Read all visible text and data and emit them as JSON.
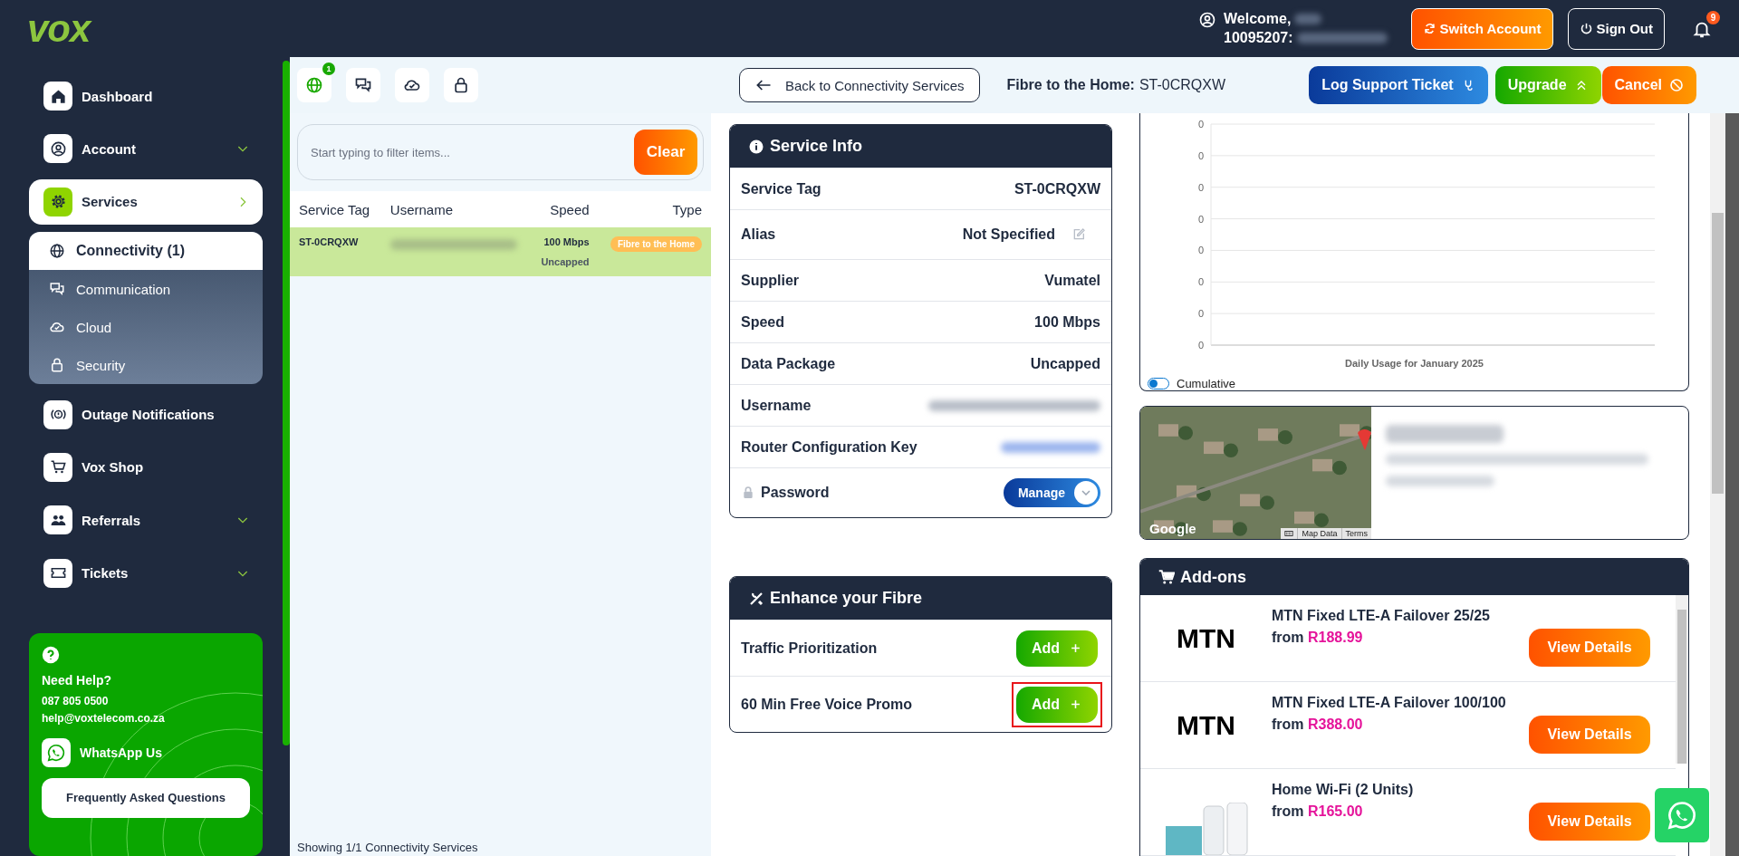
{
  "header": {
    "brand": "vox",
    "welcome": "Welcome,",
    "account_number": "10095207:",
    "buttons": [
      {
        "label": "Switch Account",
        "kind": "switch"
      },
      {
        "label": "Sign Out",
        "kind": "signout"
      }
    ],
    "notifications": {
      "count": "9"
    }
  },
  "sidebar": {
    "items": [
      {
        "label": "Dashboard",
        "has_submenu": false,
        "expanded": false,
        "selected": false
      },
      {
        "label": "Account",
        "has_submenu": true,
        "expanded": false,
        "selected": false
      },
      {
        "label": "Services",
        "has_submenu": true,
        "expanded": true,
        "selected": true,
        "children": [
          {
            "label": "Connectivity (1)",
            "selected": true
          },
          {
            "label": "Communication",
            "selected": false
          },
          {
            "label": "Cloud",
            "selected": false
          },
          {
            "label": "Security",
            "selected": false
          }
        ]
      },
      {
        "label": "Outage Notifications",
        "has_submenu": false,
        "expanded": false,
        "selected": false
      },
      {
        "label": "Vox Shop",
        "has_submenu": false,
        "expanded": false,
        "selected": false
      },
      {
        "label": "Referrals",
        "has_submenu": true,
        "expanded": false,
        "selected": false
      },
      {
        "label": "Tickets",
        "has_submenu": true,
        "expanded": false,
        "selected": false
      }
    ],
    "help": {
      "title": "Need Help?",
      "phone": "087 805 0500",
      "email": "help@voxtelecom.co.za",
      "whatsapp": "WhatsApp Us",
      "faq": "Frequently Asked Questions"
    }
  },
  "toolbar": {
    "service_tabs": [
      {
        "selected": true,
        "badge": "1"
      },
      {
        "selected": false
      },
      {
        "selected": false
      },
      {
        "selected": false
      }
    ],
    "back_button": "Back to Connectivity Services",
    "service_title": "Fibre to the Home:",
    "service_tag": "ST-0CRQXW",
    "actions": [
      {
        "label": "Log Support Ticket",
        "kind": "support"
      },
      {
        "label": "Upgrade",
        "kind": "upgrade"
      },
      {
        "label": "Cancel",
        "kind": "cancel"
      }
    ]
  },
  "filter": {
    "placeholder": "Start typing to filter items...",
    "button": "Clear"
  },
  "services_table": {
    "columns": [
      "Service Tag",
      "Username",
      "Speed",
      "Type"
    ],
    "rows": [
      {
        "service_tag": "ST-0CRQXW",
        "speed": "100 Mbps",
        "package": "Uncapped",
        "type": "Fibre to the Home",
        "selected": true
      }
    ],
    "footer": "Showing 1/1 Connectivity Services"
  },
  "service_info": {
    "title": "Service Info",
    "rows": [
      {
        "label": "Service Tag",
        "value": "ST-0CRQXW",
        "kind": "text"
      },
      {
        "label": "Alias",
        "value": "Not Specified",
        "kind": "editable"
      },
      {
        "label": "Supplier",
        "value": "Vumatel",
        "kind": "text"
      },
      {
        "label": "Speed",
        "value": "100 Mbps",
        "kind": "text"
      },
      {
        "label": "Data Package",
        "value": "Uncapped",
        "kind": "text"
      },
      {
        "label": "Username",
        "kind": "hidden"
      },
      {
        "label": "Router Configuration Key",
        "kind": "hidden_link"
      },
      {
        "label": "Password",
        "kind": "locked",
        "action": "Manage"
      }
    ]
  },
  "enhance": {
    "title": "Enhance your Fibre",
    "items": [
      {
        "label": "Traffic Prioritization",
        "button": "Add",
        "highlighted": false
      },
      {
        "label": "60 Min Free Voice Promo",
        "button": "Add",
        "highlighted": true
      }
    ]
  },
  "usage_chart": {
    "y_tick_labels": [
      "0",
      "0",
      "0",
      "0",
      "0",
      "0",
      "0",
      "0"
    ],
    "caption": "Daily Usage for January 2025",
    "cumulative": {
      "label": "Cumulative",
      "on": false
    }
  },
  "map": {
    "attribution": "Google",
    "controls": [
      "Map Data",
      "Terms"
    ]
  },
  "addons": {
    "title": "Add-ons",
    "items": [
      {
        "kind": "logo",
        "logo": "MTN",
        "name": "MTN Fixed LTE-A Failover 25/25",
        "price_prefix": "from",
        "price": "R188.99",
        "button": "View Details"
      },
      {
        "kind": "logo",
        "logo": "MTN",
        "name": "MTN Fixed LTE-A Failover 100/100",
        "price_prefix": "from",
        "price": "R388.00",
        "button": "View Details"
      },
      {
        "kind": "photo",
        "name": "Home Wi-Fi (2 Units)",
        "price_prefix": "from",
        "price": "R165.00",
        "button": "View Details"
      }
    ]
  }
}
